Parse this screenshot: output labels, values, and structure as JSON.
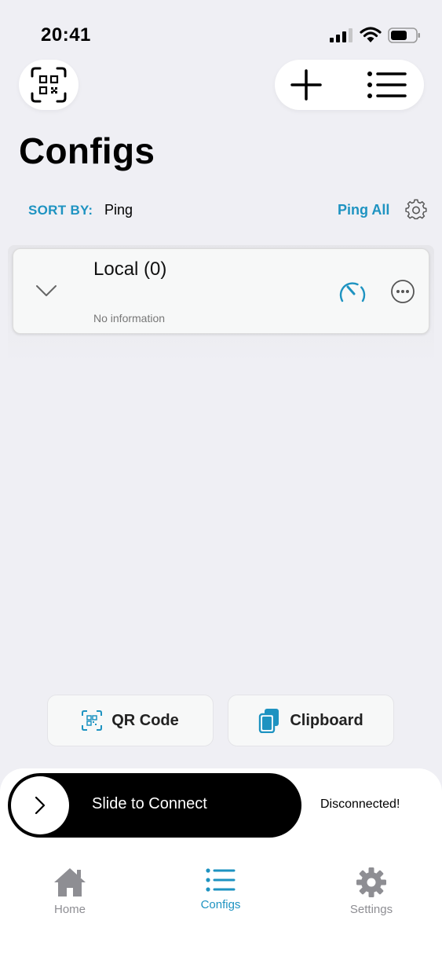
{
  "status_bar": {
    "time": "20:41"
  },
  "header": {
    "title": "Configs"
  },
  "sort": {
    "label": "SORT BY:",
    "value": "Ping",
    "ping_all_label": "Ping All"
  },
  "groups": [
    {
      "name": "Local (0)",
      "info": "No information"
    }
  ],
  "actions": {
    "qr_code_label": "QR Code",
    "clipboard_label": "Clipboard"
  },
  "connect": {
    "slider_label": "Slide to Connect",
    "status": "Disconnected!"
  },
  "tabs": [
    {
      "label": "Home",
      "icon": "home-icon"
    },
    {
      "label": "Configs",
      "icon": "list-icon",
      "active": true
    },
    {
      "label": "Settings",
      "icon": "gear-icon"
    }
  ],
  "colors": {
    "accent": "#1e93c1",
    "background": "#efeff4",
    "slider": "#000000",
    "inactive_tab": "#8e8e93"
  }
}
